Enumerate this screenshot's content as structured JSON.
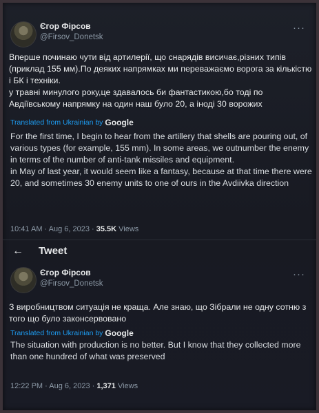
{
  "tweet1": {
    "name": "Єгор Фірсов",
    "handle": "@Firsov_Donetsk",
    "more": "···",
    "text": "Вперше починаю чути від артилерії, що снарядів висичає,різних типів (приклад 155 мм).По деяких напрямках ми переважаємо ворога за кількістю і БК і техніки.\nу травні минулого року,це здавалось би фантастикою,бо тоді по Авдіївському напрямку на один наш було 20, а іноді 30 ворожих",
    "translated_label": "Translated from Ukrainian by",
    "google": "Google",
    "translation": "For the first time, I begin to hear from the artillery that shells are pouring out, of various types (for example, 155 mm). In some areas, we outnumber the enemy in terms of the number of anti-tank missiles and equipment.\nin May of last year, it would seem like a fantasy, because at that time there were 20, and sometimes 30 enemy units to one of ours in the Avdiivka direction",
    "time": "10:41 AM · Aug 6, 2023 · ",
    "views_count": "35.5K",
    "views_label": " Views"
  },
  "nav": {
    "back": "←",
    "title": "Tweet"
  },
  "tweet2": {
    "name": "Єгор Фірсов",
    "handle": "@Firsov_Donetsk",
    "more": "···",
    "text": "З виробництвом ситуація не краща. Але знаю, що Зібрали не одну сотню з того що було законсервовано",
    "translated_label": "Translated from Ukrainian by",
    "google": "Google",
    "translation": "The situation with production is no better. But I know that they collected more than one hundred of what was preserved",
    "time": "12:22 PM · Aug 6, 2023 · ",
    "views_count": "1,371",
    "views_label": " Views"
  }
}
